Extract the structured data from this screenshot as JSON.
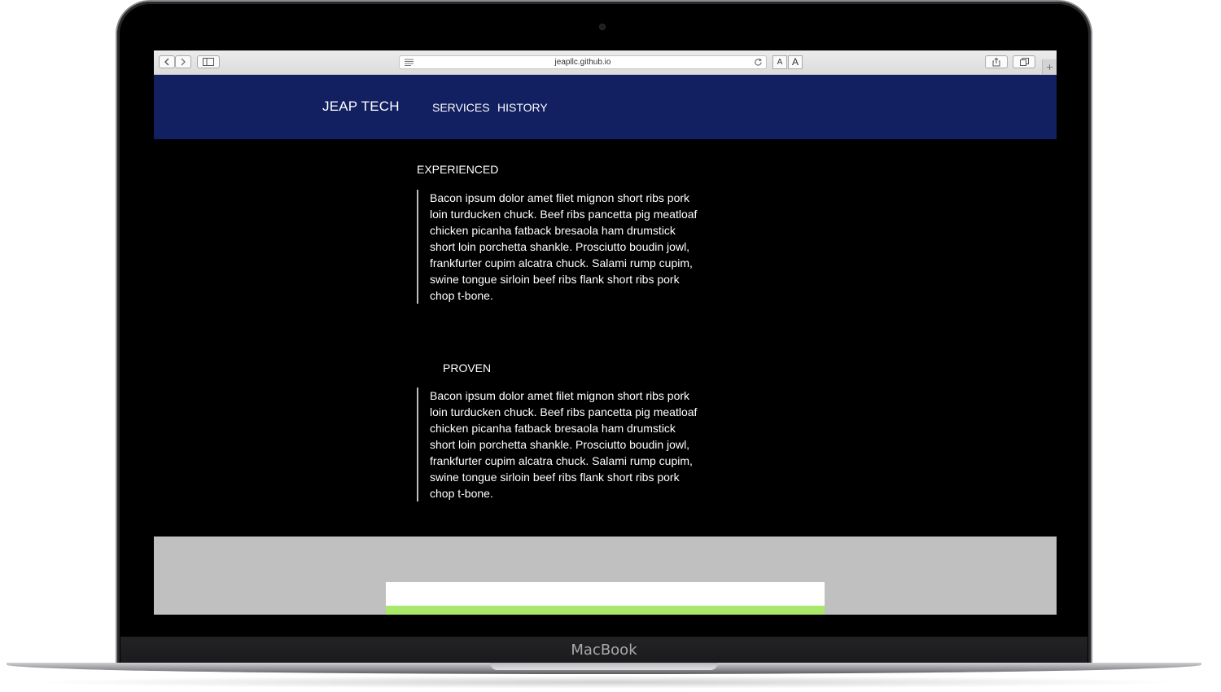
{
  "browser": {
    "url": "jeapllc.github.io",
    "font_smaller": "A",
    "font_larger": "A",
    "new_tab": "+"
  },
  "site": {
    "brand": "JEAP TECH",
    "nav": [
      "SERVICES",
      "HISTORY"
    ]
  },
  "sections": [
    {
      "title": "EXPERIENCED",
      "body": "Bacon ipsum dolor amet filet mignon short ribs pork loin turducken chuck. Beef ribs pancetta pig meatloaf chicken picanha fatback bresaola ham drumstick short loin porchetta shankle. Prosciutto boudin jowl, frankfurter cupim alcatra chuck. Salami rump cupim, swine tongue sirloin beef ribs flank short ribs pork chop t-bone."
    },
    {
      "title": "PROVEN",
      "body": "Bacon ipsum dolor amet filet mignon short ribs pork loin turducken chuck. Beef ribs pancetta pig meatloaf chicken picanha fatback bresaola ham drumstick short loin porchetta shankle. Prosciutto boudin jowl, frankfurter cupim alcatra chuck. Salami rump cupim, swine tongue sirloin beef ribs flank short ribs pork chop t-bone."
    }
  ],
  "device": {
    "label": "MacBook"
  },
  "colors": {
    "header": "#121f60",
    "page_background": "#000000",
    "footer_band": "#c0c0c0",
    "accent_strip": "#a9e86b"
  }
}
